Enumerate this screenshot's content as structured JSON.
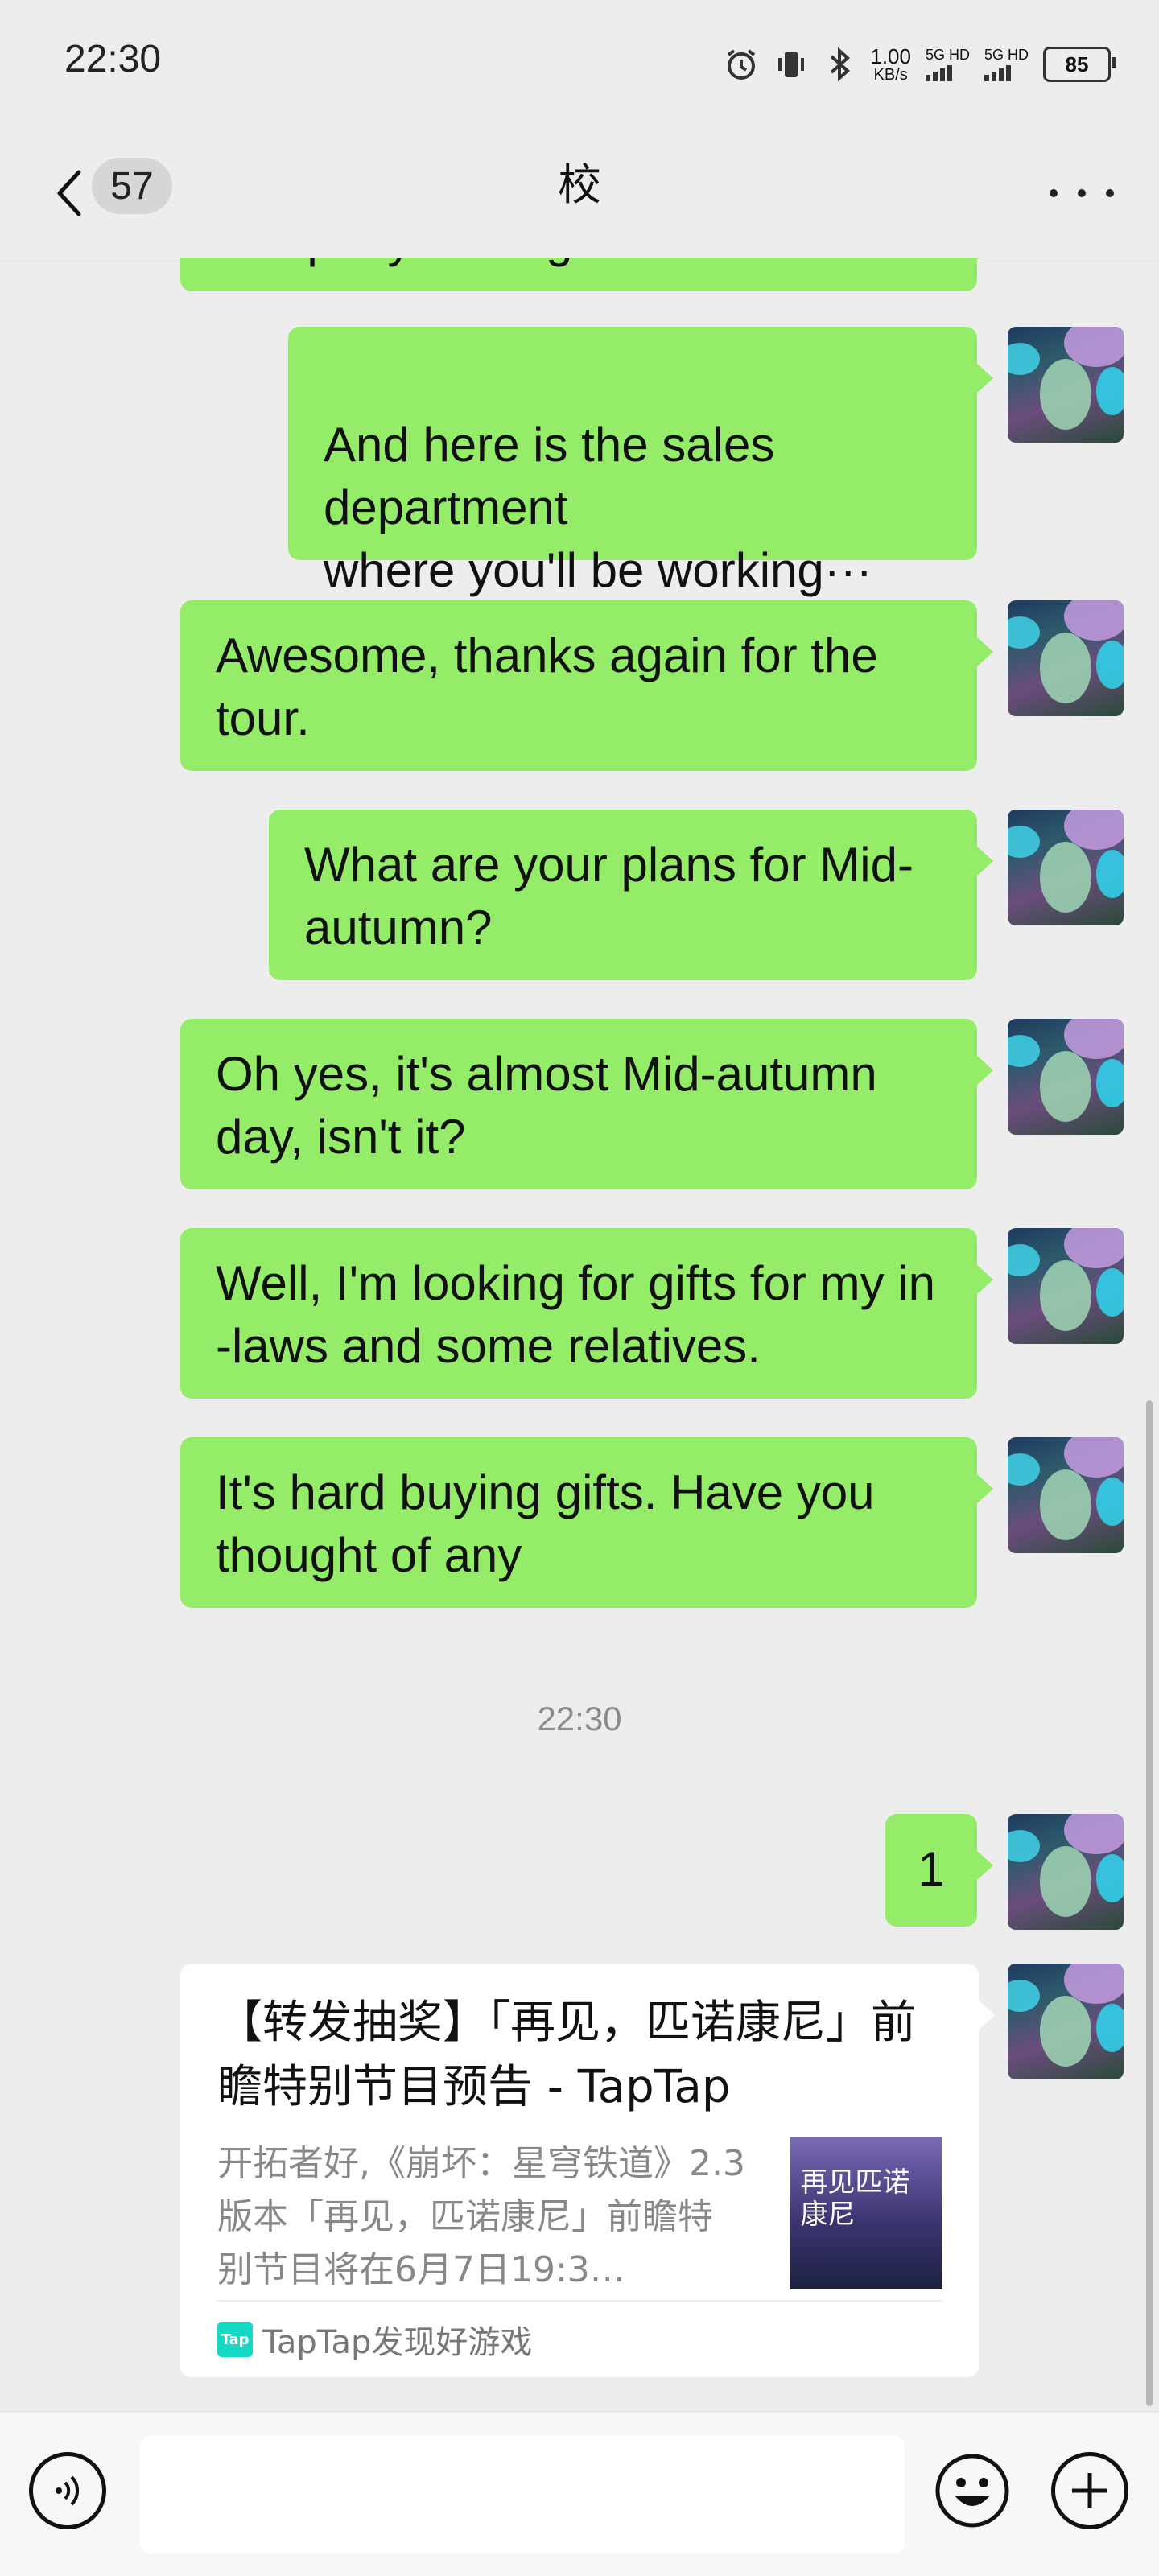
{
  "status_bar": {
    "time": "22:30",
    "net_speed_value": "1.00",
    "net_speed_unit": "KB/s",
    "sim1": "5G HD",
    "sim2": "5G HD",
    "battery": "85",
    "icons": [
      "alarm-icon",
      "vibrate-icon",
      "bluetooth-icon"
    ]
  },
  "header": {
    "title": "校",
    "unread_count": "57"
  },
  "messages": [
    {
      "text": "company strategies."
    },
    {
      "text": "And here is the sales department\nwhere you'll be working···"
    },
    {
      "text": "Awesome, thanks again for the tour."
    },
    {
      "text": "What are your plans for Mid-autumn?"
    },
    {
      "text": "Oh yes, it's almost Mid-autumn day, isn't it?"
    },
    {
      "text": "Well, I'm looking for gifts for my in -laws and some relatives."
    },
    {
      "text": "It's hard buying gifts. Have you thought of any"
    },
    {
      "text": "1"
    }
  ],
  "timestamp": "22:30",
  "link_card": {
    "title": "【转发抽奖】「再见，匹诺康尼」前瞻特别节目预告 - TapTap",
    "description": "开拓者好,《崩坏：星穹铁道》2.3版本「再见，匹诺康尼」前瞻特别节目将在6月7日19:3…",
    "source_logo": "Tap",
    "source": "TapTap发现好游戏",
    "thumb_text": "再见匹诺康尼"
  },
  "colors": {
    "bubble_green": "#95ec69",
    "background": "#ededed"
  }
}
